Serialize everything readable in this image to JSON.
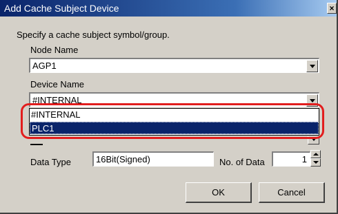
{
  "window": {
    "title": "Add Cache Subject Device",
    "close": "×"
  },
  "instructions": "Specify a cache subject symbol/group.",
  "node": {
    "label": "Node Name",
    "value": "AGP1"
  },
  "device": {
    "label": "Device Name",
    "value": "#INTERNAL",
    "options": [
      "#INTERNAL",
      "PLC1"
    ],
    "selected": "PLC1"
  },
  "data_type": {
    "label": "Data Type",
    "value": "16Bit(Signed)"
  },
  "count": {
    "label": "No. of Data",
    "value": "1"
  },
  "buttons": {
    "ok": "OK",
    "cancel": "Cancel"
  },
  "colors": {
    "titlebar": "#0a246a",
    "selection": "#0a246a",
    "highlight": "#e21d1d",
    "face": "#d4d0c8"
  }
}
